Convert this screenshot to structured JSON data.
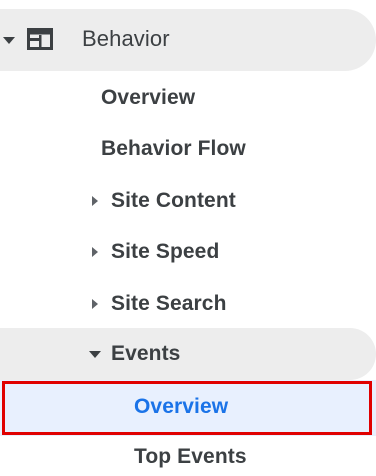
{
  "sidebar": {
    "section": {
      "label": "Behavior",
      "icon": "behavior-layout-icon",
      "expanded": true
    },
    "items": [
      {
        "label": "Overview"
      },
      {
        "label": "Behavior Flow"
      },
      {
        "label": "Site Content",
        "icon": "caret-right-icon"
      },
      {
        "label": "Site Speed",
        "icon": "caret-right-icon"
      },
      {
        "label": "Site Search",
        "icon": "caret-right-icon"
      },
      {
        "label": "Events",
        "icon": "caret-down-icon",
        "expanded": true
      }
    ],
    "events_subitems": [
      {
        "label": "Overview",
        "selected": true
      },
      {
        "label": "Top Events"
      }
    ]
  },
  "colors": {
    "active_text": "#1a73e8",
    "active_bg": "#e8f0fe",
    "section_bg": "#ededed",
    "text": "#3c4043",
    "highlight_border": "#e00000"
  }
}
